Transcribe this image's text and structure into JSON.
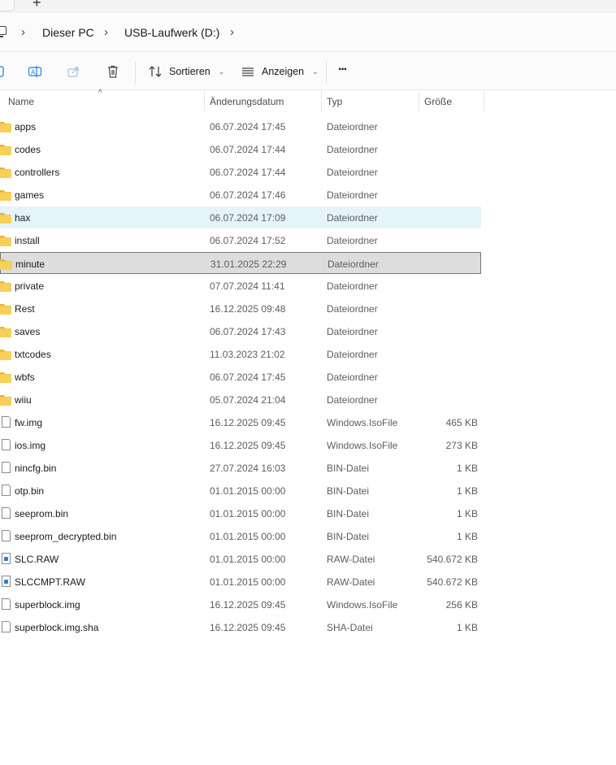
{
  "tabstrip": {
    "close_glyph": "×",
    "new_tab_glyph": "+"
  },
  "breadcrumb": {
    "items": [
      "Dieser PC",
      "USB-Laufwerk (D:)"
    ],
    "separator": "›"
  },
  "commandbar": {
    "sort_label": "Sortieren",
    "view_label": "Anzeigen",
    "more_glyph": "···",
    "icons": [
      "copy-icon",
      "rename-icon",
      "share-icon",
      "delete-icon",
      "sort-icon",
      "view-icon",
      "more-icon"
    ]
  },
  "columns": {
    "name": "Name",
    "date": "Änderungsdatum",
    "type": "Typ",
    "size": "Größe",
    "sort_glyph": "^"
  },
  "files": [
    {
      "name": "apps",
      "date": "06.07.2024 17:45",
      "type": "Dateiordner",
      "size": "",
      "kind": "folder"
    },
    {
      "name": "codes",
      "date": "06.07.2024 17:44",
      "type": "Dateiordner",
      "size": "",
      "kind": "folder"
    },
    {
      "name": "controllers",
      "date": "06.07.2024 17:44",
      "type": "Dateiordner",
      "size": "",
      "kind": "folder"
    },
    {
      "name": "games",
      "date": "06.07.2024 17:46",
      "type": "Dateiordner",
      "size": "",
      "kind": "folder"
    },
    {
      "name": "hax",
      "date": "06.07.2024 17:09",
      "type": "Dateiordner",
      "size": "",
      "kind": "folder",
      "state": "hover"
    },
    {
      "name": "install",
      "date": "06.07.2024 17:52",
      "type": "Dateiordner",
      "size": "",
      "kind": "folder"
    },
    {
      "name": "minute",
      "date": "31.01.2025 22:29",
      "type": "Dateiordner",
      "size": "",
      "kind": "folder",
      "state": "selected"
    },
    {
      "name": "private",
      "date": "07.07.2024 11:41",
      "type": "Dateiordner",
      "size": "",
      "kind": "folder"
    },
    {
      "name": "Rest",
      "date": "16.12.2025 09:48",
      "type": "Dateiordner",
      "size": "",
      "kind": "folder"
    },
    {
      "name": "saves",
      "date": "06.07.2024 17:43",
      "type": "Dateiordner",
      "size": "",
      "kind": "folder"
    },
    {
      "name": "txtcodes",
      "date": "11.03.2023 21:02",
      "type": "Dateiordner",
      "size": "",
      "kind": "folder"
    },
    {
      "name": "wbfs",
      "date": "06.07.2024 17:45",
      "type": "Dateiordner",
      "size": "",
      "kind": "folder"
    },
    {
      "name": "wiiu",
      "date": "05.07.2024 21:04",
      "type": "Dateiordner",
      "size": "",
      "kind": "folder"
    },
    {
      "name": "fw.img",
      "date": "16.12.2025 09:45",
      "type": "Windows.IsoFile",
      "size": "465 KB",
      "kind": "file"
    },
    {
      "name": "ios.img",
      "date": "16.12.2025 09:45",
      "type": "Windows.IsoFile",
      "size": "273 KB",
      "kind": "file"
    },
    {
      "name": "nincfg.bin",
      "date": "27.07.2024 16:03",
      "type": "BIN-Datei",
      "size": "1 KB",
      "kind": "file"
    },
    {
      "name": "otp.bin",
      "date": "01.01.2015 00:00",
      "type": "BIN-Datei",
      "size": "1 KB",
      "kind": "file"
    },
    {
      "name": "seeprom.bin",
      "date": "01.01.2015 00:00",
      "type": "BIN-Datei",
      "size": "1 KB",
      "kind": "file"
    },
    {
      "name": "seeprom_decrypted.bin",
      "date": "01.01.2015 00:00",
      "type": "BIN-Datei",
      "size": "1 KB",
      "kind": "file"
    },
    {
      "name": "SLC.RAW",
      "date": "01.01.2015 00:00",
      "type": "RAW-Datei",
      "size": "540.672 KB",
      "kind": "raw"
    },
    {
      "name": "SLCCMPT.RAW",
      "date": "01.01.2015 00:00",
      "type": "RAW-Datei",
      "size": "540.672 KB",
      "kind": "raw"
    },
    {
      "name": "superblock.img",
      "date": "16.12.2025 09:45",
      "type": "Windows.IsoFile",
      "size": "256 KB",
      "kind": "file"
    },
    {
      "name": "superblock.img.sha",
      "date": "16.12.2025 09:45",
      "type": "SHA-Datei",
      "size": "1 KB",
      "kind": "file"
    }
  ]
}
